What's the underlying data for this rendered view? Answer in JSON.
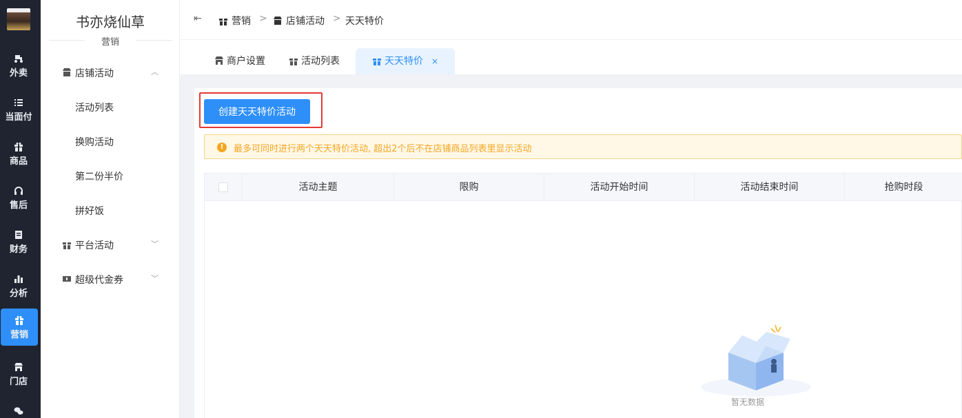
{
  "rail": {
    "items": [
      {
        "label": "外卖",
        "icon": "bike-icon"
      },
      {
        "label": "当面付",
        "icon": "list-icon"
      },
      {
        "label": "商品",
        "icon": "gift-icon"
      },
      {
        "label": "售后",
        "icon": "headset-icon"
      },
      {
        "label": "财务",
        "icon": "ledger-icon"
      },
      {
        "label": "分析",
        "icon": "bar-chart-icon"
      },
      {
        "label": "营销",
        "icon": "gift-icon",
        "active": true
      },
      {
        "label": "门店",
        "icon": "store-icon"
      }
    ]
  },
  "sidebar": {
    "shop_name": "书亦烧仙草",
    "section": "营销",
    "groups": [
      {
        "label": "店铺活动",
        "expanded": true,
        "items": [
          "活动列表",
          "换购活动",
          "第二份半价",
          "拼好饭"
        ]
      },
      {
        "label": "平台活动",
        "expanded": false
      },
      {
        "label": "超级代金券",
        "expanded": false
      }
    ]
  },
  "header": {
    "breadcrumb": [
      "营销",
      "店铺活动",
      "天天特价"
    ],
    "separator": ">"
  },
  "tabs": [
    {
      "label": "商户设置"
    },
    {
      "label": "活动列表"
    },
    {
      "label": "天天特价",
      "active": true,
      "close": "×"
    }
  ],
  "main": {
    "create_button": "创建天天特价活动",
    "notice": "最多可同时进行两个天天特价活动, 超出2个后不在店铺商品列表里显示活动",
    "notice_icon": "!",
    "table": {
      "columns": [
        "活动主题",
        "限购",
        "活动开始时间",
        "活动结束时间",
        "抢购时段"
      ]
    },
    "empty_text": "暂无数据"
  },
  "colors": {
    "primary": "#2e8ff9",
    "rail_bg": "#1f2430",
    "warning": "#f5a623",
    "highlight": "#e53935"
  }
}
